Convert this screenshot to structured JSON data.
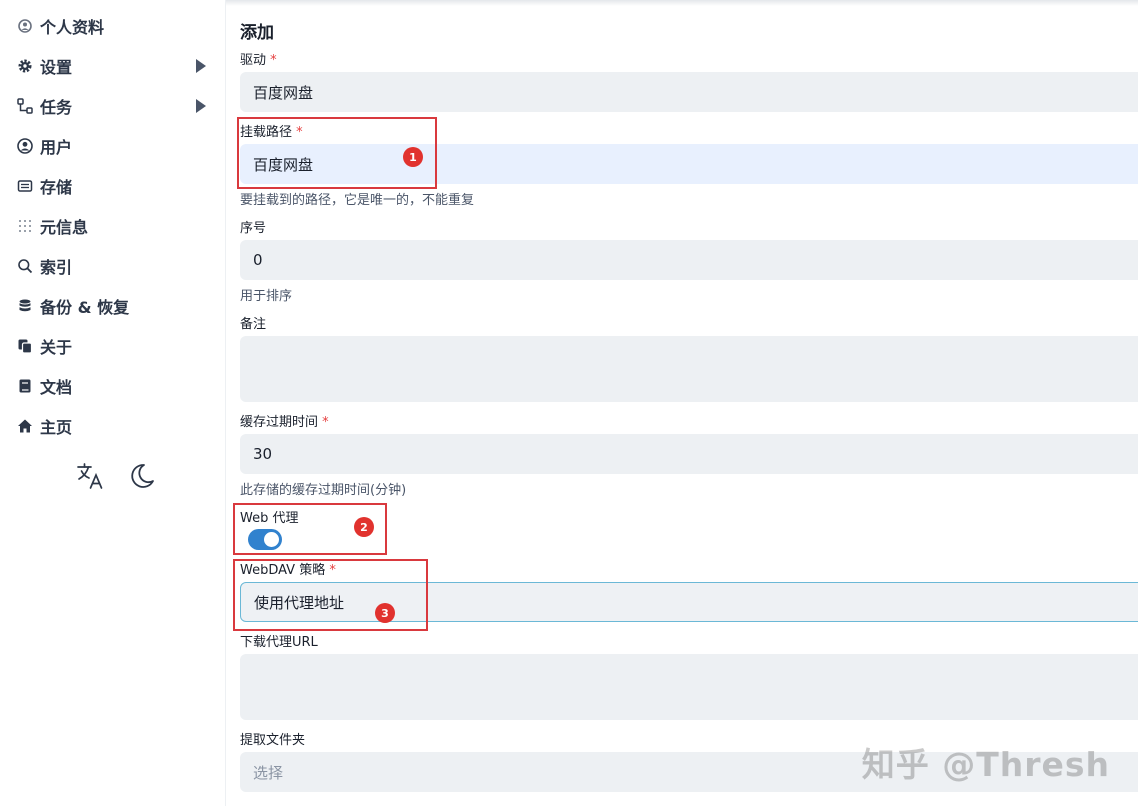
{
  "sidebar": {
    "items": [
      {
        "label": "个人资料",
        "icon": "user-circle-icon"
      },
      {
        "label": "设置",
        "icon": "gear-icon",
        "expandable": true
      },
      {
        "label": "任务",
        "icon": "tasks-icon",
        "expandable": true
      },
      {
        "label": "用户",
        "icon": "user-icon"
      },
      {
        "label": "存储",
        "icon": "storage-icon"
      },
      {
        "label": "元信息",
        "icon": "metadata-icon"
      },
      {
        "label": "索引",
        "icon": "search-icon"
      },
      {
        "label": "备份 & 恢复",
        "icon": "database-icon"
      },
      {
        "label": "关于",
        "icon": "copy-icon"
      },
      {
        "label": "文档",
        "icon": "book-icon"
      },
      {
        "label": "主页",
        "icon": "home-icon"
      }
    ],
    "tools": [
      "language-icon",
      "moon-icon"
    ]
  },
  "form": {
    "title": "添加",
    "driver": {
      "label": "驱动",
      "value": "百度网盘"
    },
    "mount_path": {
      "label": "挂载路径",
      "value": "百度网盘",
      "help": "要挂载到的路径，它是唯一的，不能重复"
    },
    "order": {
      "label": "序号",
      "value": "0",
      "help": "用于排序"
    },
    "remark": {
      "label": "备注",
      "value": ""
    },
    "cache_expiration": {
      "label": "缓存过期时间",
      "value": "30",
      "help": "此存储的缓存过期时间(分钟)"
    },
    "web_proxy": {
      "label": "Web 代理",
      "enabled": true
    },
    "webdav_policy": {
      "label": "WebDAV 策略",
      "value": "使用代理地址"
    },
    "download_proxy_url": {
      "label": "下载代理URL",
      "value": ""
    },
    "extract_folder": {
      "label": "提取文件夹",
      "placeholder": "选择"
    },
    "required_mark": "*"
  },
  "annotations": {
    "badge1": "1",
    "badge2": "2",
    "badge3": "3"
  },
  "watermark": "知乎 @Thresh",
  "colors": {
    "accent": "#3182ce",
    "annotation_red": "#d9393e",
    "required": "#e53e3e"
  }
}
